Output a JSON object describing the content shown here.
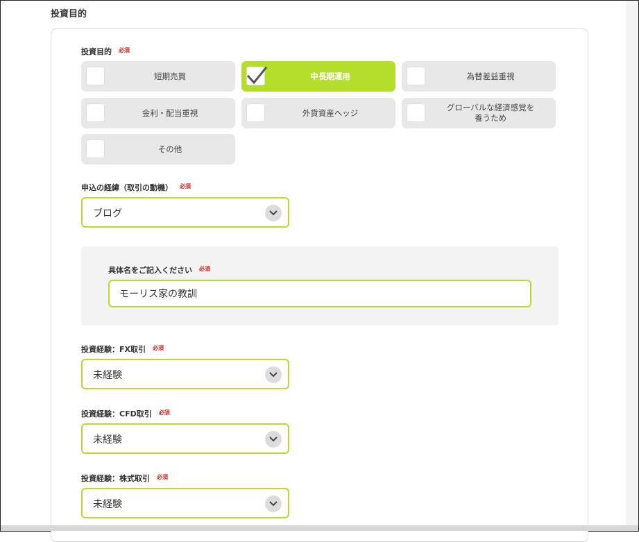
{
  "section": {
    "title": "投資目的"
  },
  "purpose": {
    "label": "投資目的",
    "required": "必須",
    "options": [
      {
        "label": "短期売買",
        "checked": false
      },
      {
        "label": "中長期運用",
        "checked": true
      },
      {
        "label": "為替差益重視",
        "checked": false
      },
      {
        "label": "金利・配当重視",
        "checked": false
      },
      {
        "label": "外貨資産ヘッジ",
        "checked": false
      },
      {
        "label": "グローバルな経済感覚を\n養うため",
        "checked": false
      },
      {
        "label": "その他",
        "checked": false
      }
    ]
  },
  "motive": {
    "label": "申込の経緯（取引の動機）",
    "required": "必須",
    "value": "ブログ"
  },
  "detail": {
    "label": "具体名をご記入ください",
    "required": "必須",
    "value": "モーリス家の教訓"
  },
  "fx": {
    "label": "投資経験：FX取引",
    "required": "必須",
    "value": "未経験"
  },
  "cfd": {
    "label": "投資経験：CFD取引",
    "required": "必須",
    "value": "未経験"
  },
  "stock": {
    "label": "投資経験：株式取引",
    "required": "必須",
    "value": "未経験"
  },
  "colors": {
    "accent": "#b5dd2c",
    "required": "#e02020",
    "option_bg": "#e8e8e8"
  }
}
